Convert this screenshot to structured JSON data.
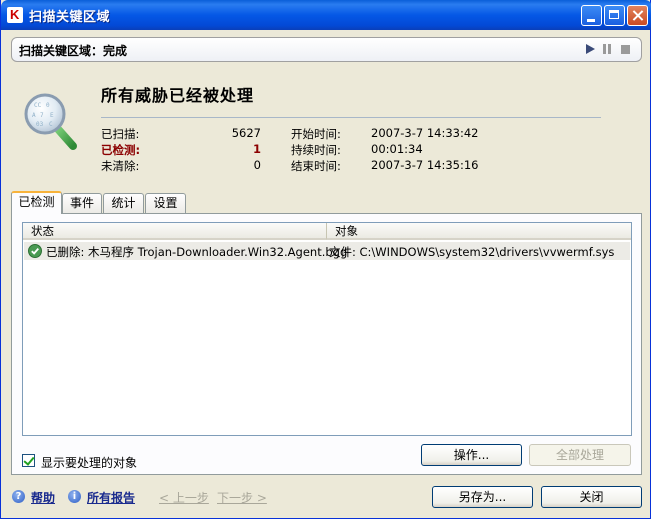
{
  "window": {
    "title": "扫描关键区域"
  },
  "status_header": {
    "text": "扫描关键区域：完成"
  },
  "headline": "所有威胁已经被处理",
  "stats": {
    "scanned_label": "已扫描:",
    "scanned_value": "5627",
    "detected_label": "已检测:",
    "detected_value": "1",
    "uncleaned_label": "未清除:",
    "uncleaned_value": "0",
    "start_label": "开始时间:",
    "start_value": "2007-3-7 14:33:42",
    "duration_label": "持续时间:",
    "duration_value": "00:01:34",
    "end_label": "结束时间:",
    "end_value": "2007-3-7 14:35:16"
  },
  "tabs": [
    {
      "label": "已检测",
      "active": true
    },
    {
      "label": "事件",
      "active": false
    },
    {
      "label": "统计",
      "active": false
    },
    {
      "label": "设置",
      "active": false
    }
  ],
  "table": {
    "columns": [
      "状态",
      "对象"
    ],
    "rows": [
      {
        "state": "已删除: 木马程序 Trojan-Downloader.Win32.Agent.bgg",
        "object": "文件: C:\\WINDOWS\\system32\\drivers\\vvwermf.sys"
      }
    ]
  },
  "show_objects_checkbox": {
    "label": "显示要处理的对象",
    "checked": true
  },
  "buttons": {
    "action": "操作...",
    "process_all": "全部处理",
    "save_as": "另存为...",
    "close": "关闭"
  },
  "footer": {
    "help": "帮助",
    "all_reports": "所有报告",
    "prev": "< 上一步",
    "next": "下一步 >"
  },
  "colors": {
    "titlebar": "#0558e6",
    "detected": "#8b0000",
    "active_tab": "#f8b33b"
  }
}
